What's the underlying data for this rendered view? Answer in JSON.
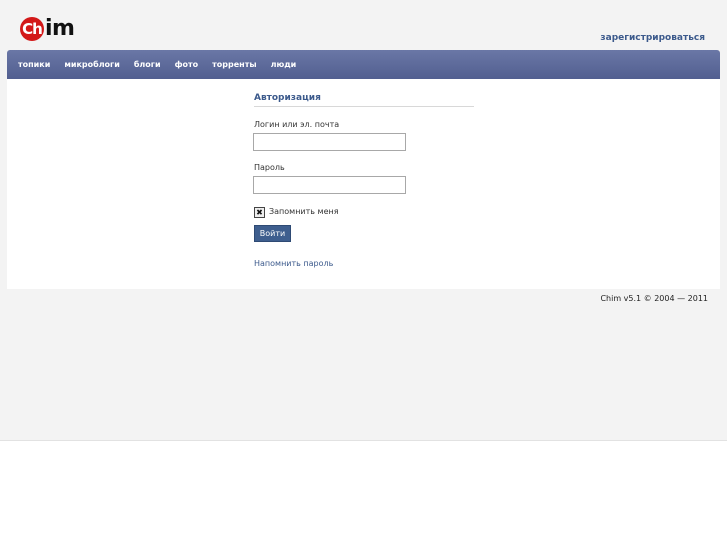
{
  "header": {
    "logo": {
      "mark": "Ch",
      "text": "im"
    },
    "register_link": "зарегистрироваться"
  },
  "nav": {
    "items": [
      {
        "label": "топики"
      },
      {
        "label": "микроблоги"
      },
      {
        "label": "блоги"
      },
      {
        "label": "фото"
      },
      {
        "label": "торренты"
      },
      {
        "label": "люди"
      }
    ]
  },
  "auth": {
    "title": "Авторизация",
    "login_label": "Логин или эл. почта",
    "login_value": "",
    "password_label": "Пароль",
    "password_value": "",
    "remember_label": "Запомнить меня",
    "remember_checked": true,
    "submit_label": "Войти",
    "remind_link": "Напомнить пароль"
  },
  "footer": {
    "text": "Chim v5.1 © 2004 — 2011"
  },
  "colors": {
    "nav_bar": "#5d6a9b",
    "accent_link": "#3c5a8c",
    "button": "#3e5e8e",
    "logo_red": "#d31818"
  }
}
